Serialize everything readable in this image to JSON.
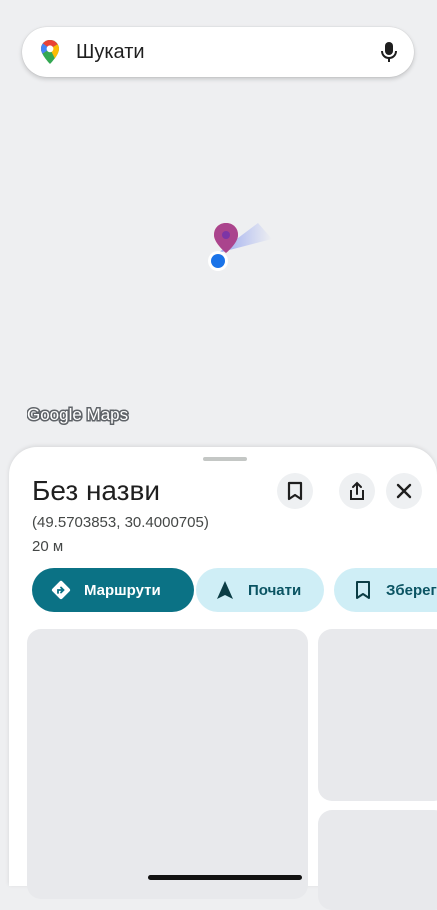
{
  "search": {
    "placeholder": "Шукати",
    "logo_icon": "google-maps-pin-icon",
    "mic_icon": "microphone-icon"
  },
  "map": {
    "watermark": "Google Maps",
    "marker_icon": "location-pin-icon",
    "current_location_icon": "blue-dot-icon"
  },
  "place": {
    "title": "Без назви",
    "coordinates": "(49.5703853, 30.4000705)",
    "distance": "20 м"
  },
  "header_buttons": {
    "save_icon": "bookmark-icon",
    "share_icon": "share-icon",
    "close_icon": "close-icon"
  },
  "actions": [
    {
      "label": "Маршрути",
      "icon": "directions-icon"
    },
    {
      "label": "Почати",
      "icon": "navigation-arrow-icon"
    },
    {
      "label": "Зберег",
      "icon": "bookmark-icon"
    }
  ],
  "colors": {
    "primary": "#0b7285",
    "chip_bg": "#cfeef6",
    "chip_text": "#0b5463",
    "location_blue": "#1a73e8",
    "pin_red": "#e53935"
  }
}
